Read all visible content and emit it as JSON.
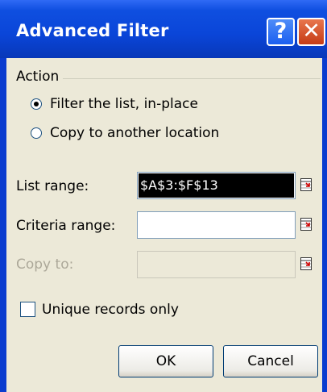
{
  "window": {
    "title": "Advanced Filter",
    "help_glyph": "?",
    "close_glyph": "✕"
  },
  "action": {
    "group_label": "Action",
    "options": [
      {
        "label": "Filter the list, in-place",
        "selected": true
      },
      {
        "label": "Copy to another location",
        "selected": false
      }
    ]
  },
  "fields": {
    "list_range": {
      "label": "List range:",
      "value": "$A$3:$F$13"
    },
    "criteria_range": {
      "label": "Criteria range:",
      "value": ""
    },
    "copy_to": {
      "label": "Copy to:",
      "value": ""
    }
  },
  "unique": {
    "label": "Unique records only",
    "checked": false
  },
  "buttons": {
    "ok": "OK",
    "cancel": "Cancel"
  },
  "colors": {
    "title_bar": "#0a45d8",
    "close_button": "#c53b15",
    "help_button": "#1b5ff0",
    "selection": "#000000"
  }
}
